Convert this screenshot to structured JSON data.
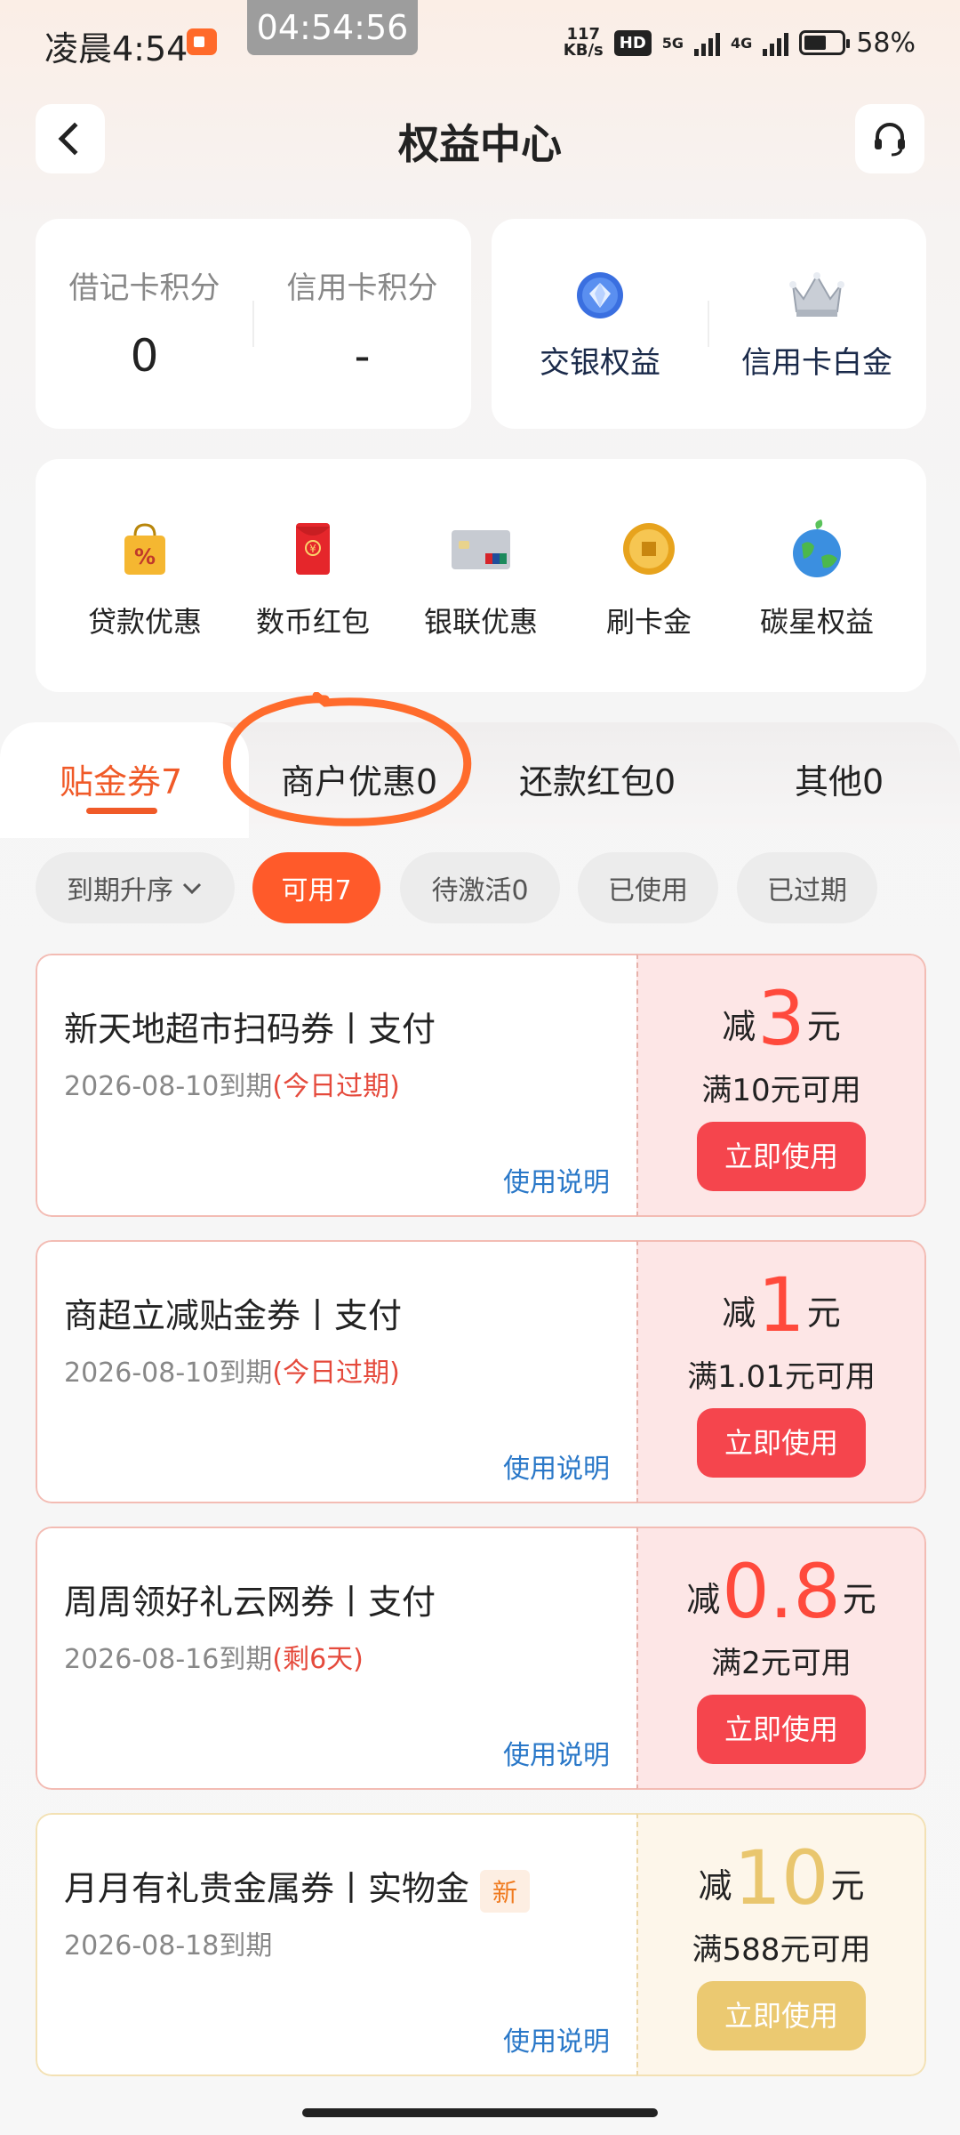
{
  "status_bar": {
    "time": "凌晨4:54",
    "clock_overlay": "04:54:56",
    "speed_value": "117",
    "speed_unit": "KB/s",
    "hd_label": "HD",
    "sig1_label": "5G",
    "sig2_label": "4G",
    "battery_pct": "58%"
  },
  "header": {
    "title": "权益中心"
  },
  "points_card": {
    "debit_label": "借记卡积分",
    "debit_value": "0",
    "credit_label": "信用卡积分",
    "credit_value": "-"
  },
  "rights_card": {
    "item1_label": "交银权益",
    "item2_label": "信用卡白金"
  },
  "shortcuts": [
    {
      "label": "贷款优惠",
      "icon": "bag-percent-icon"
    },
    {
      "label": "数币红包",
      "icon": "red-envelope-icon"
    },
    {
      "label": "银联优惠",
      "icon": "unionpay-card-icon"
    },
    {
      "label": "刷卡金",
      "icon": "gold-coin-icon"
    },
    {
      "label": "碳星权益",
      "icon": "globe-icon"
    }
  ],
  "tabs": [
    {
      "label": "贴金券7"
    },
    {
      "label": "商户优惠0"
    },
    {
      "label": "还款红包0"
    },
    {
      "label": "其他0"
    }
  ],
  "filters": {
    "sort_label": "到期升序",
    "chips": [
      "可用7",
      "待激活0",
      "已使用",
      "已过期"
    ]
  },
  "coupons": [
    {
      "title": "新天地超市扫码券丨支付",
      "date": "2026-08-10到期",
      "expiry_note": "(今日过期)",
      "prefix": "减",
      "amount": "3",
      "suffix": "元",
      "condition": "满10元可用",
      "button": "立即使用",
      "help": "使用说明"
    },
    {
      "title": "商超立减贴金券丨支付",
      "date": "2026-08-10到期",
      "expiry_note": "(今日过期)",
      "prefix": "减",
      "amount": "1",
      "suffix": "元",
      "condition": "满1.01元可用",
      "button": "立即使用",
      "help": "使用说明"
    },
    {
      "title": "周周领好礼云网券丨支付",
      "date": "2026-08-16到期",
      "expiry_note": "(剩6天)",
      "prefix": "减",
      "amount": "0.8",
      "suffix": "元",
      "condition": "满2元可用",
      "button": "立即使用",
      "help": "使用说明"
    },
    {
      "title": "月月有礼贵金属券丨实物金",
      "badge": "新",
      "date": "2026-08-18到期",
      "prefix": "减",
      "amount": "10",
      "suffix": "元",
      "condition": "满588元可用",
      "button": "立即使用",
      "help": "使用说明"
    }
  ],
  "colors": {
    "accent": "#f05a28",
    "coupon_red": "#ff4a3c",
    "coupon_gold": "#e9c66e",
    "link_blue": "#2a78c8"
  }
}
